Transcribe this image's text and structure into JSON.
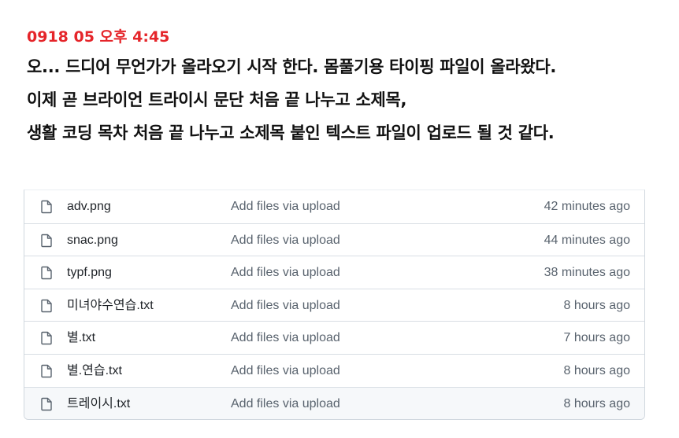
{
  "note": {
    "timestamp": "0918 05 오후 4:45",
    "lines": [
      "오... 드디어 무언가가 올라오기 시작 한다. 몸풀기용 타이핑 파일이 올라왔다.",
      "이제 곧 브라이언 트라이시 문단 처음 끝 나누고 소제목,",
      "생활 코딩 목차 처음 끝 나누고 소제목 붙인 텍스트 파일이 업로드 될 것 같다."
    ]
  },
  "files": [
    {
      "name": "adv.png",
      "message": "Add files via upload",
      "time": "42 minutes ago",
      "icon": "file-icon"
    },
    {
      "name": "snac.png",
      "message": "Add files via upload",
      "time": "44 minutes ago",
      "icon": "file-icon"
    },
    {
      "name": "typf.png",
      "message": "Add files via upload",
      "time": "38 minutes ago",
      "icon": "file-icon"
    },
    {
      "name": "미녀야수연습.txt",
      "message": "Add files via upload",
      "time": "8 hours ago",
      "icon": "file-icon"
    },
    {
      "name": "별.txt",
      "message": "Add files via upload",
      "time": "7 hours ago",
      "icon": "file-icon"
    },
    {
      "name": "별.연습.txt",
      "message": "Add files via upload",
      "time": "8 hours ago",
      "icon": "file-icon"
    },
    {
      "name": "트레이시.txt",
      "message": "Add files via upload",
      "time": "8 hours ago",
      "icon": "file-icon"
    }
  ],
  "colors": {
    "timestamp": "#e5252a",
    "muted_text": "#59636e",
    "border": "#d0d7de"
  }
}
